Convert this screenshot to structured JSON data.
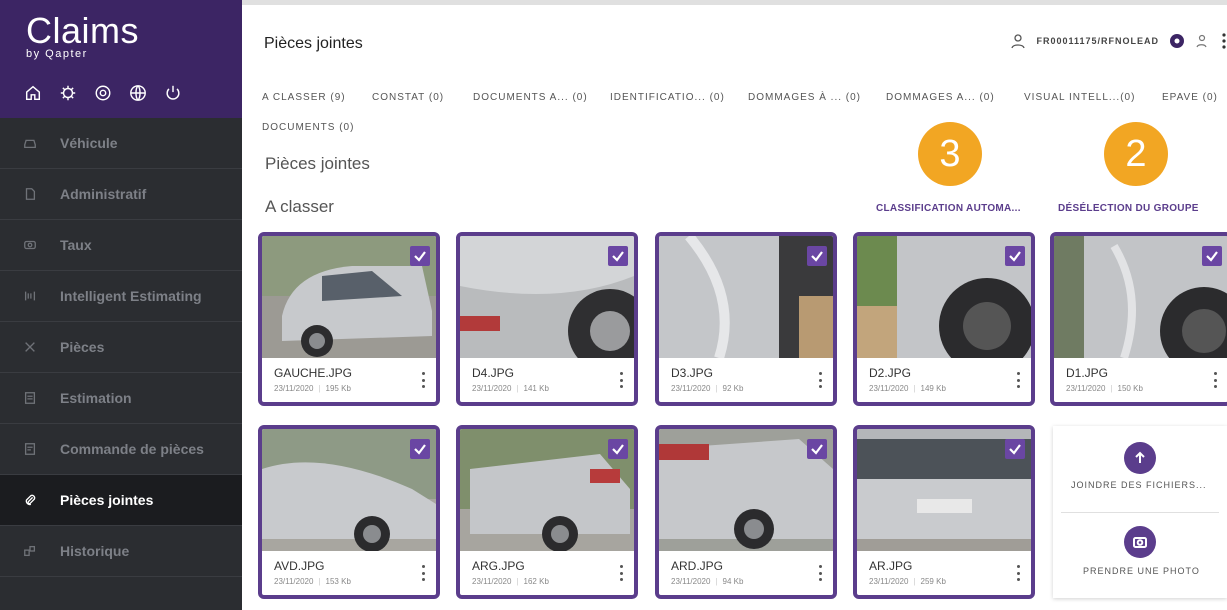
{
  "brand": {
    "title": "Claims",
    "subtitle": "by Qapter"
  },
  "sidebar": {
    "items": [
      {
        "label": "Véhicule"
      },
      {
        "label": "Administratif"
      },
      {
        "label": "Taux"
      },
      {
        "label": "Intelligent Estimating"
      },
      {
        "label": "Pièces"
      },
      {
        "label": "Estimation"
      },
      {
        "label": "Commande de pièces"
      },
      {
        "label": "Pièces jointes",
        "active": true
      },
      {
        "label": "Historique"
      }
    ]
  },
  "header": {
    "title": "Pièces jointes",
    "user_id": "FR00011175/RFNOLEAD"
  },
  "tabs": [
    "A CLASSER (9)",
    "CONSTAT (0)",
    "DOCUMENTS A... (0)",
    "IDENTIFICATIO... (0)",
    "DOMMAGES À ... (0)",
    "DOMMAGES A... (0)",
    "VISUAL INTELL...(0)",
    "EPAVE (0)",
    "DOCUMENTS (0)"
  ],
  "main": {
    "section_title": "Pièces jointes",
    "group_title": "A classer",
    "auto_classification": "CLASSIFICATION AUTOMA...",
    "deselect_group": "DÉSÉLECTION DU GROUPE"
  },
  "badges": {
    "b3": "3",
    "b2": "2"
  },
  "files": [
    {
      "name": "GAUCHE.JPG",
      "date": "23/11/2020",
      "size": "195 Kb"
    },
    {
      "name": "D4.JPG",
      "date": "23/11/2020",
      "size": "141 Kb"
    },
    {
      "name": "D3.JPG",
      "date": "23/11/2020",
      "size": "92 Kb"
    },
    {
      "name": "D2.JPG",
      "date": "23/11/2020",
      "size": "149 Kb"
    },
    {
      "name": "D1.JPG",
      "date": "23/11/2020",
      "size": "150 Kb"
    },
    {
      "name": "AVD.JPG",
      "date": "23/11/2020",
      "size": "153 Kb"
    },
    {
      "name": "ARG.JPG",
      "date": "23/11/2020",
      "size": "162 Kb"
    },
    {
      "name": "ARD.JPG",
      "date": "23/11/2020",
      "size": "94 Kb"
    },
    {
      "name": "AR.JPG",
      "date": "23/11/2020",
      "size": "259 Kb"
    }
  ],
  "upload": {
    "join_files": "JOINDRE DES FICHIERS...",
    "take_photo": "PRENDRE UNE PHOTO"
  },
  "colors": {
    "brand_purple": "#3c2564",
    "accent_purple": "#5b3d8c",
    "badge_orange": "#f2a623",
    "sidebar_bg": "#2b2d31"
  }
}
